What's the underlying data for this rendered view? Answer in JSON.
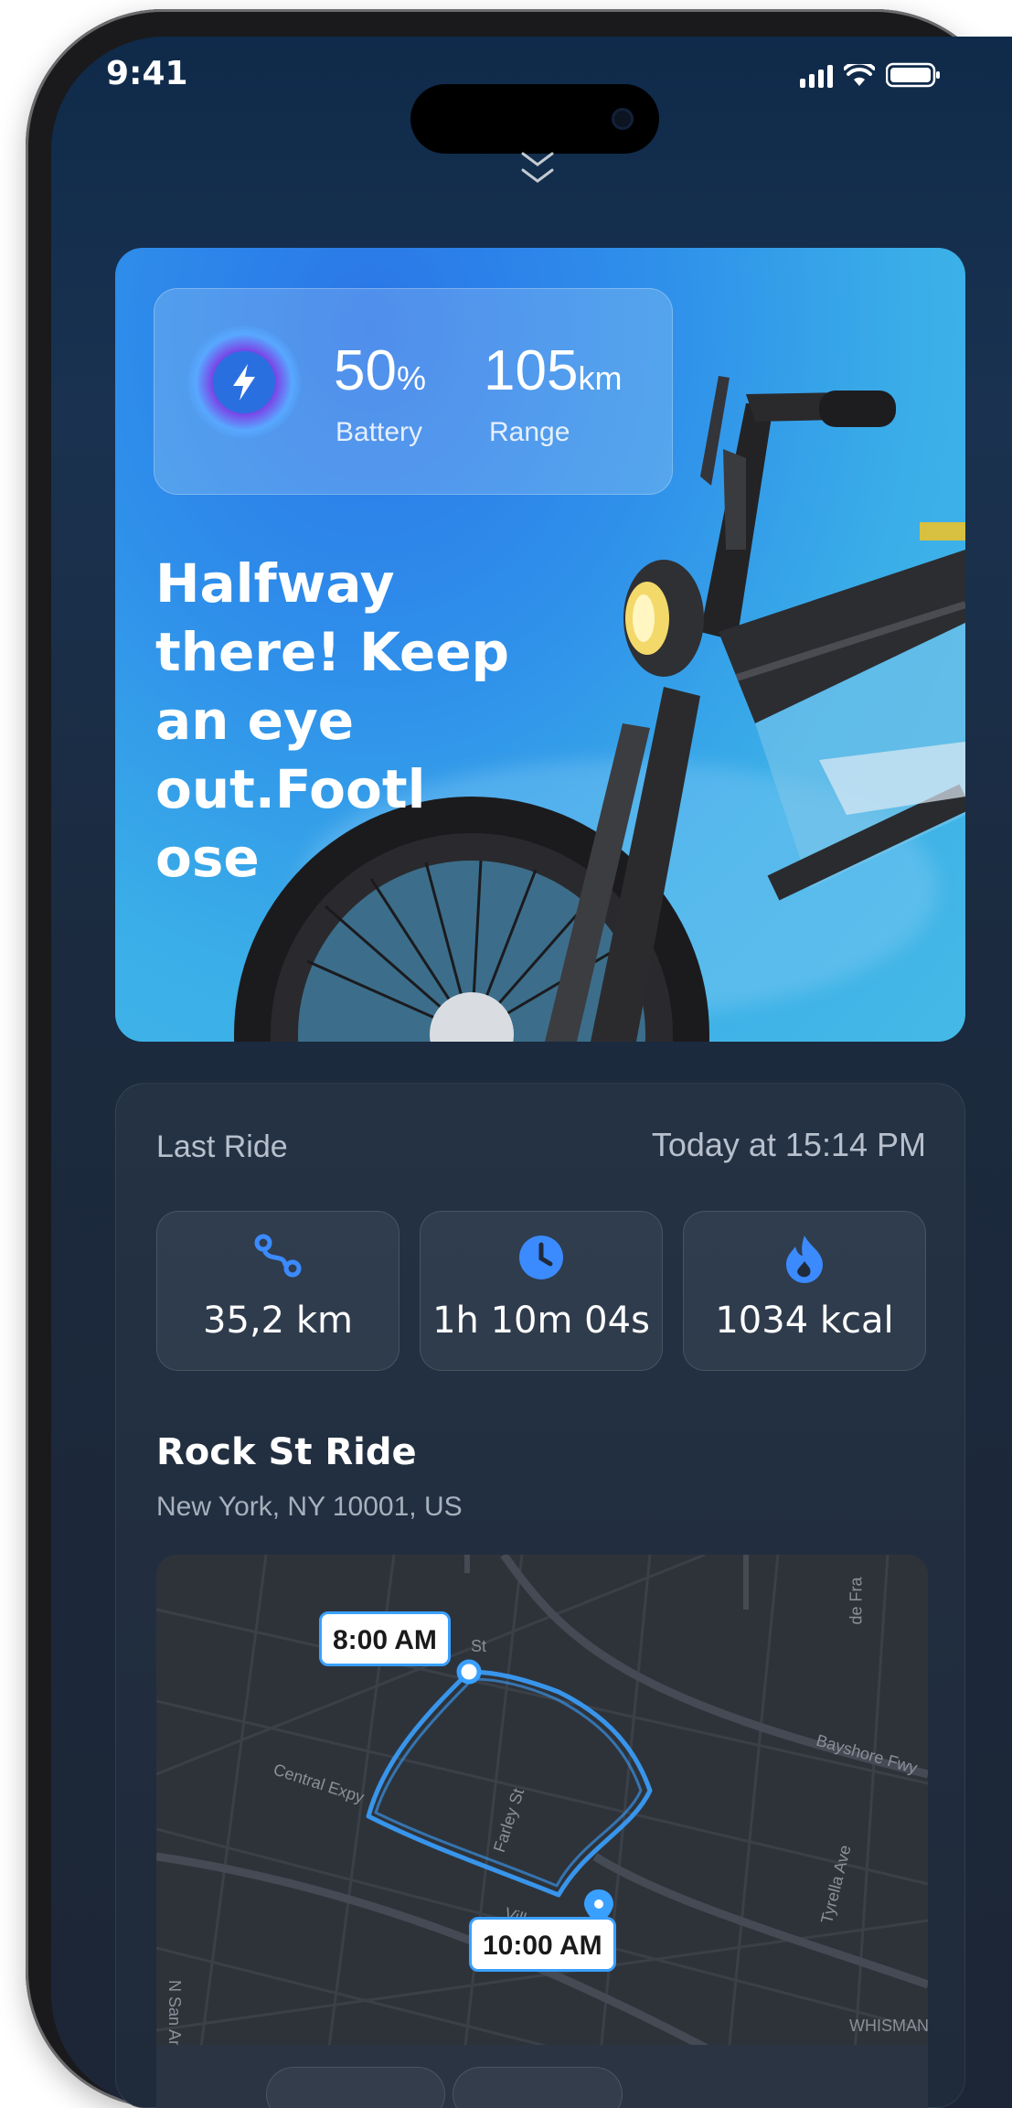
{
  "status_bar": {
    "time": "9:41"
  },
  "hero": {
    "battery_value": "50",
    "battery_unit": "%",
    "battery_label": "Battery",
    "range_value": "105",
    "range_unit": "km",
    "range_label": "Range",
    "headline_lines": [
      "Halfway",
      "there! Keep",
      "an eye",
      "out.Footl",
      "ose"
    ]
  },
  "last_ride": {
    "label": "Last Ride",
    "time": "Today at 15:14 PM",
    "stats": [
      {
        "icon": "route-icon",
        "value": "35,2 km"
      },
      {
        "icon": "clock-icon",
        "value": "1h 10m 04s"
      },
      {
        "icon": "flame-icon",
        "value": "1034 kcal"
      }
    ],
    "ride_name": "Rock St Ride",
    "address": "New York, NY 10001, US",
    "map": {
      "start_time": "8:00 AM",
      "end_time": "10:00 AM",
      "street_labels": [
        "Central Expy",
        "Farley St",
        "Villa St",
        "Bayshore Fwy",
        "Tyrella Ave",
        "N San Anto",
        "WHISMAN",
        "de Fra",
        "St"
      ]
    }
  },
  "colors": {
    "accent": "#3aa0ff",
    "flame": "#3b8bff",
    "card": "#243244"
  }
}
